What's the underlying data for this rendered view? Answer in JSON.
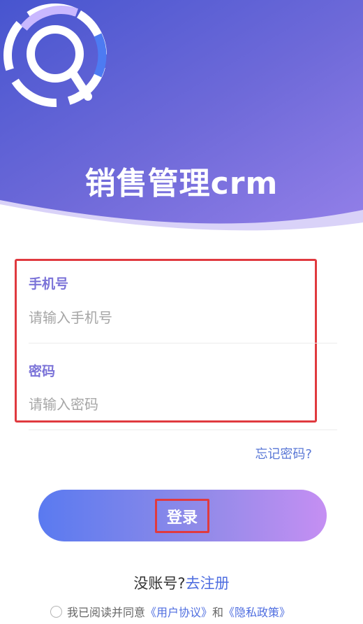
{
  "app": {
    "title": "销售管理crm"
  },
  "form": {
    "phone": {
      "label": "手机号",
      "placeholder": "请输入手机号",
      "value": ""
    },
    "password": {
      "label": "密码",
      "placeholder": "请输入密码",
      "value": ""
    },
    "forgot_label": "忘记密码?"
  },
  "login": {
    "label": "登录"
  },
  "signup": {
    "prompt": "没账号?",
    "link": "去注册"
  },
  "agreement": {
    "prefix": "我已阅读并同意",
    "user_agreement": "《用户协议》",
    "and": "和",
    "privacy_policy": "《隐私政策》"
  },
  "colors": {
    "hero_start": "#4f5fd6",
    "hero_end": "#8d7fe6",
    "accent": "#4f6ee0",
    "label": "#7b73d8",
    "highlight": "#e03a3f"
  },
  "icons": {
    "logo": "search-magnifier-logo",
    "radio": "radio-unchecked"
  }
}
